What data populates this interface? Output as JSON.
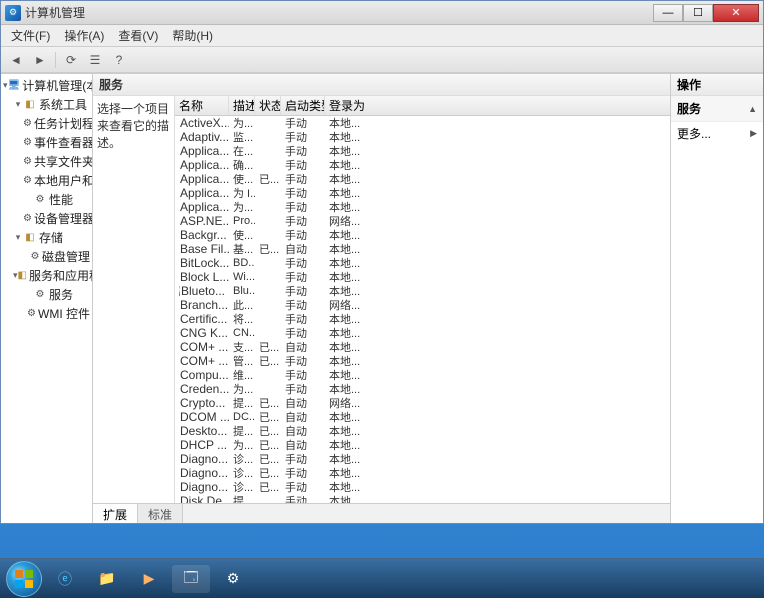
{
  "window": {
    "title": "计算机管理"
  },
  "menu": {
    "file": "文件(F)",
    "action": "操作(A)",
    "view": "查看(V)",
    "help": "帮助(H)"
  },
  "tree": [
    {
      "level": 0,
      "exp": "▾",
      "icon": "root",
      "label": "计算机管理(本地"
    },
    {
      "level": 1,
      "exp": "▾",
      "icon": "folder",
      "label": "系统工具"
    },
    {
      "level": 2,
      "exp": "",
      "icon": "gear",
      "label": "任务计划程"
    },
    {
      "level": 2,
      "exp": "",
      "icon": "gear",
      "label": "事件查看器"
    },
    {
      "level": 2,
      "exp": "",
      "icon": "gear",
      "label": "共享文件夹"
    },
    {
      "level": 2,
      "exp": "",
      "icon": "gear",
      "label": "本地用户和"
    },
    {
      "level": 2,
      "exp": "",
      "icon": "gear",
      "label": "性能"
    },
    {
      "level": 2,
      "exp": "",
      "icon": "gear",
      "label": "设备管理器"
    },
    {
      "level": 1,
      "exp": "▾",
      "icon": "folder",
      "label": "存储"
    },
    {
      "level": 2,
      "exp": "",
      "icon": "gear",
      "label": "磁盘管理"
    },
    {
      "level": 1,
      "exp": "▾",
      "icon": "folder",
      "label": "服务和应用程"
    },
    {
      "level": 2,
      "exp": "",
      "icon": "gear",
      "label": "服务"
    },
    {
      "level": 2,
      "exp": "",
      "icon": "gear",
      "label": "WMI 控件"
    }
  ],
  "middleTitle": "服务",
  "descText": "选择一个项目来查看它的描述。",
  "columns": {
    "name": "名称",
    "desc": "描述",
    "state": "状态",
    "start": "启动类型",
    "logon": "登录为"
  },
  "services": [
    {
      "name": "ActiveX...",
      "desc": "为...",
      "state": "",
      "start": "手动",
      "logon": "本地..."
    },
    {
      "name": "Adaptiv...",
      "desc": "监...",
      "state": "",
      "start": "手动",
      "logon": "本地..."
    },
    {
      "name": "Applica...",
      "desc": "在...",
      "state": "",
      "start": "手动",
      "logon": "本地..."
    },
    {
      "name": "Applica...",
      "desc": "确...",
      "state": "",
      "start": "手动",
      "logon": "本地..."
    },
    {
      "name": "Applica...",
      "desc": "使...",
      "state": "已...",
      "start": "手动",
      "logon": "本地..."
    },
    {
      "name": "Applica...",
      "desc": "为 I...",
      "state": "",
      "start": "手动",
      "logon": "本地..."
    },
    {
      "name": "Applica...",
      "desc": "为...",
      "state": "",
      "start": "手动",
      "logon": "本地..."
    },
    {
      "name": "ASP.NE...",
      "desc": "Pro...",
      "state": "",
      "start": "手动",
      "logon": "网络..."
    },
    {
      "name": "Backgr...",
      "desc": "使...",
      "state": "",
      "start": "手动",
      "logon": "本地..."
    },
    {
      "name": "Base Fil...",
      "desc": "基...",
      "state": "已...",
      "start": "自动",
      "logon": "本地..."
    },
    {
      "name": "BitLock...",
      "desc": "BD...",
      "state": "",
      "start": "手动",
      "logon": "本地..."
    },
    {
      "name": "Block L...",
      "desc": "Wi...",
      "state": "",
      "start": "手动",
      "logon": "本地..."
    },
    {
      "name": "Blueto...",
      "desc": "Blu...",
      "state": "",
      "start": "手动",
      "logon": "本地..."
    },
    {
      "name": "Branch...",
      "desc": "此...",
      "state": "",
      "start": "手动",
      "logon": "网络..."
    },
    {
      "name": "Certific...",
      "desc": "将...",
      "state": "",
      "start": "手动",
      "logon": "本地..."
    },
    {
      "name": "CNG K...",
      "desc": "CN...",
      "state": "",
      "start": "手动",
      "logon": "本地..."
    },
    {
      "name": "COM+ ...",
      "desc": "支...",
      "state": "已...",
      "start": "自动",
      "logon": "本地..."
    },
    {
      "name": "COM+ ...",
      "desc": "管...",
      "state": "已...",
      "start": "手动",
      "logon": "本地..."
    },
    {
      "name": "Compu...",
      "desc": "维...",
      "state": "",
      "start": "手动",
      "logon": "本地..."
    },
    {
      "name": "Creden...",
      "desc": "为...",
      "state": "",
      "start": "手动",
      "logon": "本地..."
    },
    {
      "name": "Crypto...",
      "desc": "提...",
      "state": "已...",
      "start": "自动",
      "logon": "网络..."
    },
    {
      "name": "DCOM ...",
      "desc": "DC...",
      "state": "已...",
      "start": "自动",
      "logon": "本地..."
    },
    {
      "name": "Deskto...",
      "desc": "提...",
      "state": "已...",
      "start": "自动",
      "logon": "本地..."
    },
    {
      "name": "DHCP ...",
      "desc": "为...",
      "state": "已...",
      "start": "自动",
      "logon": "本地..."
    },
    {
      "name": "Diagno...",
      "desc": "诊...",
      "state": "已...",
      "start": "手动",
      "logon": "本地..."
    },
    {
      "name": "Diagno...",
      "desc": "诊...",
      "state": "已...",
      "start": "手动",
      "logon": "本地..."
    },
    {
      "name": "Diagno...",
      "desc": "诊...",
      "state": "已...",
      "start": "手动",
      "logon": "本地..."
    },
    {
      "name": "Disk De...",
      "desc": "提...",
      "state": "",
      "start": "手动",
      "logon": "本地..."
    }
  ],
  "tabs": {
    "extended": "扩展",
    "standard": "标准"
  },
  "actions": {
    "header": "操作",
    "section": "服务",
    "more": "更多..."
  }
}
